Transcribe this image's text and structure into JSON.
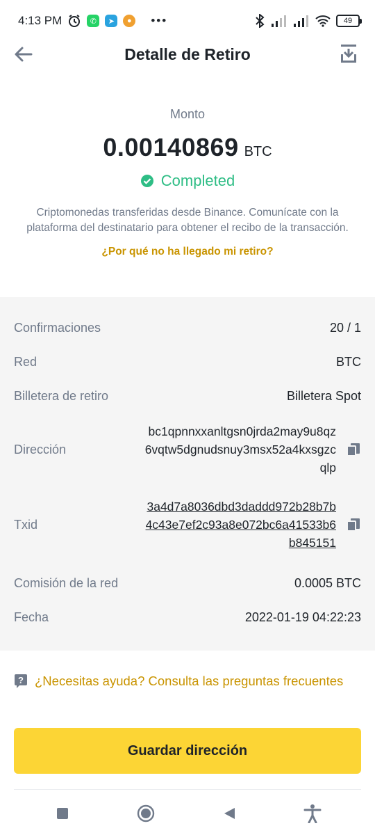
{
  "status_bar": {
    "time": "4:13 PM",
    "dots": "•••",
    "battery": "49"
  },
  "header": {
    "title": "Detalle de Retiro"
  },
  "summary": {
    "amount_label": "Monto",
    "amount": "0.00140869",
    "unit": "BTC",
    "status": "Completed",
    "description": "Criptomonedas transferidas desde Binance. Comunícate con la plataforma del destinatario para obtener el recibo de la transacción.",
    "why_link": "¿Por qué no ha llegado mi retiro?"
  },
  "details": {
    "confirmations_label": "Confirmaciones",
    "confirmations_value": "20 / 1",
    "network_label": "Red",
    "network_value": "BTC",
    "wallet_label": "Billetera de retiro",
    "wallet_value": "Billetera Spot",
    "address_label": "Dirección",
    "address_value": "bc1qpnnxxanltgsn0jrda2may9u8qz6vqtw5dgnudsnuy3msx52a4kxsgzcqlp",
    "txid_label": "Txid",
    "txid_value": "3a4d7a8036dbd3daddd972b28b7b4c43e7ef2c93a8e072bc6a41533b6b845151",
    "fee_label": "Comisión de la red",
    "fee_value": "0.0005 BTC",
    "date_label": "Fecha",
    "date_value": "2022-01-19 04:22:23"
  },
  "help": {
    "text": "¿Necesitas ayuda? Consulta las preguntas frecuentes"
  },
  "actions": {
    "save_label": "Guardar dirección"
  },
  "colors": {
    "accent": "#fcd535",
    "link": "#c99400",
    "success": "#2ebd85",
    "muted": "#707a8a",
    "panel": "#f5f5f5"
  }
}
